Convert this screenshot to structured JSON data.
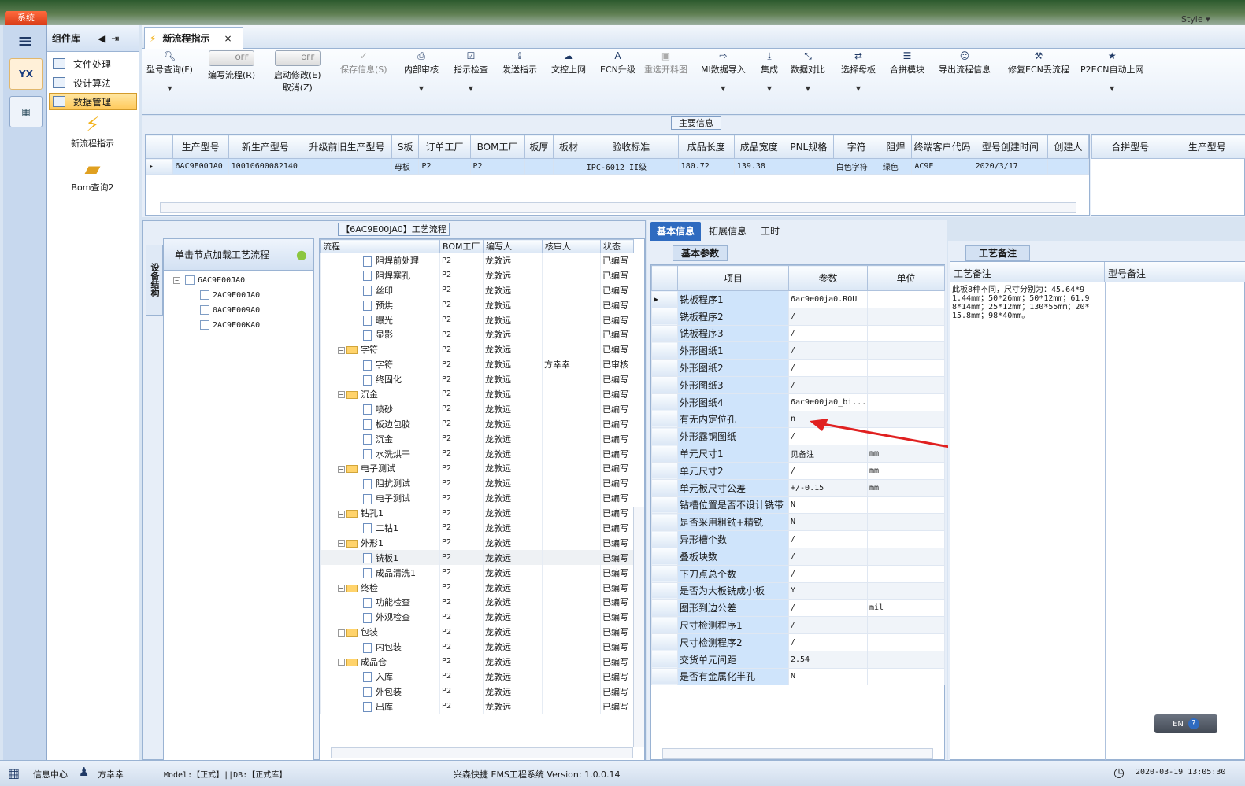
{
  "window": {
    "system_tab": "系统",
    "style_label": "Style"
  },
  "nav": {
    "tile1": "YX",
    "tile2": "▦"
  },
  "component_panel": {
    "title": "组件库",
    "items": [
      {
        "label": "文件处理"
      },
      {
        "label": "设计算法"
      },
      {
        "label": "数据管理"
      }
    ],
    "big_items": [
      {
        "label": "新流程指示"
      },
      {
        "label": "Bom查询2"
      }
    ]
  },
  "tab": {
    "label": "新流程指示",
    "close": "×"
  },
  "toolbar": {
    "model_query": "型号查询(F)",
    "edit_flow": "编写流程(R)",
    "start_modify": "启动修改(E)",
    "cancel": "取消(Z)",
    "toggle_off": "OFF",
    "save_info": "保存信息(S)",
    "internal_review": "内部审核",
    "instruction_check": "指示检查",
    "send_instruction": "发送指示",
    "doc_control_online": "文控上网",
    "ecn_upgrade": "ECN升级",
    "reselect_drawing": "重选开料图",
    "mi_import": "MI数据导入",
    "integrate": "集成",
    "data_compare": "数据对比",
    "select_master": "选择母板",
    "merge_module": "合拼模块",
    "export_flow": "导出流程信息",
    "fix_ecn": "修复ECN丢流程",
    "p2ecn": "P2ECN自动上网"
  },
  "main_info": {
    "title": "主要信息",
    "columns": [
      "生产型号",
      "新生产型号",
      "升级前旧生产型号",
      "S板",
      "订单工厂",
      "BOM工厂",
      "板厚",
      "板材",
      "验收标准",
      "成品长度",
      "成品宽度",
      "PNL规格",
      "字符",
      "阻焊",
      "终端客户代码",
      "型号创建时间",
      "创建人"
    ],
    "rows": [
      [
        "6AC9E00JA0",
        "10010600082140",
        "",
        "母板",
        "P2",
        "P2",
        "",
        "",
        "IPC-6012 II级",
        "180.72",
        "139.38",
        "",
        "白色字符",
        "绿色",
        "AC9E",
        "2020/3/17",
        ""
      ]
    ],
    "merge_columns": [
      "合拼型号",
      "生产型号"
    ]
  },
  "process": {
    "title": "【6AC9E00JA0】工艺流程",
    "side_tab": "设备结构",
    "tree_header": "单击节点加载工艺流程",
    "tree": [
      {
        "label": "6AC9E00JA0",
        "level": 0
      },
      {
        "label": "2AC9E00JA0",
        "level": 1
      },
      {
        "label": "0AC9E009A0",
        "level": 1
      },
      {
        "label": "2AC9E00KA0",
        "level": 1
      }
    ],
    "columns": [
      "流程",
      "BOM工厂",
      "编写人",
      "核审人",
      "状态"
    ],
    "rows": [
      {
        "name": "阻焊前处理",
        "type": "doc",
        "bom": "P2",
        "writer": "龙敦远",
        "reviewer": "",
        "status": "已编写"
      },
      {
        "name": "阻焊塞孔",
        "type": "doc",
        "bom": "P2",
        "writer": "龙敦远",
        "reviewer": "",
        "status": "已编写"
      },
      {
        "name": "丝印",
        "type": "doc",
        "bom": "P2",
        "writer": "龙敦远",
        "reviewer": "",
        "status": "已编写"
      },
      {
        "name": "预烘",
        "type": "doc",
        "bom": "P2",
        "writer": "龙敦远",
        "reviewer": "",
        "status": "已编写"
      },
      {
        "name": "曝光",
        "type": "doc",
        "bom": "P2",
        "writer": "龙敦远",
        "reviewer": "",
        "status": "已编写"
      },
      {
        "name": "显影",
        "type": "doc",
        "bom": "P2",
        "writer": "龙敦远",
        "reviewer": "",
        "status": "已编写"
      },
      {
        "name": "字符",
        "type": "folder",
        "bom": "P2",
        "writer": "龙敦远",
        "reviewer": "",
        "status": "已编写"
      },
      {
        "name": "字符",
        "type": "doc",
        "bom": "P2",
        "writer": "龙敦远",
        "reviewer": "方幸幸",
        "status": "已审核"
      },
      {
        "name": "终固化",
        "type": "doc",
        "bom": "P2",
        "writer": "龙敦远",
        "reviewer": "",
        "status": "已编写"
      },
      {
        "name": "沉金",
        "type": "folder",
        "bom": "P2",
        "writer": "龙敦远",
        "reviewer": "",
        "status": "已编写"
      },
      {
        "name": "喷砂",
        "type": "doc",
        "bom": "P2",
        "writer": "龙敦远",
        "reviewer": "",
        "status": "已编写"
      },
      {
        "name": "板边包胶",
        "type": "doc",
        "bom": "P2",
        "writer": "龙敦远",
        "reviewer": "",
        "status": "已编写"
      },
      {
        "name": "沉金",
        "type": "doc",
        "bom": "P2",
        "writer": "龙敦远",
        "reviewer": "",
        "status": "已编写"
      },
      {
        "name": "水洗烘干",
        "type": "doc",
        "bom": "P2",
        "writer": "龙敦远",
        "reviewer": "",
        "status": "已编写"
      },
      {
        "name": "电子测试",
        "type": "folder",
        "bom": "P2",
        "writer": "龙敦远",
        "reviewer": "",
        "status": "已编写"
      },
      {
        "name": "阻抗测试",
        "type": "doc",
        "bom": "P2",
        "writer": "龙敦远",
        "reviewer": "",
        "status": "已编写"
      },
      {
        "name": "电子测试",
        "type": "doc",
        "bom": "P2",
        "writer": "龙敦远",
        "reviewer": "",
        "status": "已编写"
      },
      {
        "name": "钻孔1",
        "type": "folder",
        "bom": "P2",
        "writer": "龙敦远",
        "reviewer": "",
        "status": "已编写"
      },
      {
        "name": "二钻1",
        "type": "doc",
        "bom": "P2",
        "writer": "龙敦远",
        "reviewer": "",
        "status": "已编写"
      },
      {
        "name": "外形1",
        "type": "folder",
        "bom": "P2",
        "writer": "龙敦远",
        "reviewer": "",
        "status": "已编写"
      },
      {
        "name": "铣板1",
        "type": "doc",
        "bom": "P2",
        "writer": "龙敦远",
        "reviewer": "",
        "status": "已编写",
        "selected": true
      },
      {
        "name": "成品清洗1",
        "type": "doc",
        "bom": "P2",
        "writer": "龙敦远",
        "reviewer": "",
        "status": "已编写"
      },
      {
        "name": "终检",
        "type": "folder",
        "bom": "P2",
        "writer": "龙敦远",
        "reviewer": "",
        "status": "已编写"
      },
      {
        "name": "功能检查",
        "type": "doc",
        "bom": "P2",
        "writer": "龙敦远",
        "reviewer": "",
        "status": "已编写"
      },
      {
        "name": "外观检查",
        "type": "doc",
        "bom": "P2",
        "writer": "龙敦远",
        "reviewer": "",
        "status": "已编写"
      },
      {
        "name": "包装",
        "type": "folder",
        "bom": "P2",
        "writer": "龙敦远",
        "reviewer": "",
        "status": "已编写"
      },
      {
        "name": "内包装",
        "type": "doc",
        "bom": "P2",
        "writer": "龙敦远",
        "reviewer": "",
        "status": "已编写"
      },
      {
        "name": "成品仓",
        "type": "folder",
        "bom": "P2",
        "writer": "龙敦远",
        "reviewer": "",
        "status": "已编写"
      },
      {
        "name": "入库",
        "type": "doc",
        "bom": "P2",
        "writer": "龙敦远",
        "reviewer": "",
        "status": "已编写"
      },
      {
        "name": "外包装",
        "type": "doc",
        "bom": "P2",
        "writer": "龙敦远",
        "reviewer": "",
        "status": "已编写"
      },
      {
        "name": "出库",
        "type": "doc",
        "bom": "P2",
        "writer": "龙敦远",
        "reviewer": "",
        "status": "已编写"
      }
    ]
  },
  "basic": {
    "tabs": [
      "基本信息",
      "拓展信息",
      "工时"
    ],
    "title": "基本参数",
    "columns": [
      "项目",
      "参数",
      "单位"
    ],
    "rows": [
      [
        "铣板程序1",
        "6ac9e00ja0.ROU",
        ""
      ],
      [
        "铣板程序2",
        "/",
        ""
      ],
      [
        "铣板程序3",
        "/",
        ""
      ],
      [
        "外形图纸1",
        "/",
        ""
      ],
      [
        "外形图纸2",
        "/",
        ""
      ],
      [
        "外形图纸3",
        "/",
        ""
      ],
      [
        "外形图纸4",
        "6ac9e00ja0_bi...",
        ""
      ],
      [
        "有无内定位孔",
        "n",
        ""
      ],
      [
        "外形露铜图纸",
        "/",
        ""
      ],
      [
        "单元尺寸1",
        "见备注",
        "mm"
      ],
      [
        "单元尺寸2",
        "/",
        "mm"
      ],
      [
        "单元板尺寸公差",
        "+/-0.15",
        "mm"
      ],
      [
        "钻槽位置是否不设计铣带",
        "N",
        ""
      ],
      [
        "是否采用粗铣+精铣",
        "N",
        ""
      ],
      [
        "异形槽个数",
        "/",
        ""
      ],
      [
        "叠板块数",
        "/",
        ""
      ],
      [
        "下刀点总个数",
        "/",
        ""
      ],
      [
        "是否为大板铣成小板",
        "Y",
        ""
      ],
      [
        "图形到边公差",
        "/",
        "mil"
      ],
      [
        "尺寸检测程序1",
        "/",
        ""
      ],
      [
        "尺寸检测程序2",
        "/",
        ""
      ],
      [
        "交货单元间距",
        "2.54",
        ""
      ],
      [
        "是否有金属化半孔",
        "N",
        ""
      ]
    ]
  },
  "remarks": {
    "title": "工艺备注",
    "col1": "工艺备注",
    "col2": "型号备注",
    "text": "此板8种不同，尺寸分别为：45.64*91.44mm；50*26mm；50*12mm；61.98*14mm；25*12mm；130*55mm；20*15.8mm；98*40mm。"
  },
  "lang": {
    "code": "EN"
  },
  "status": {
    "info_center": "信息中心",
    "user": "方幸幸",
    "model_db": "Model:【正式】||DB:【正式库】",
    "system": "兴森快捷 EMS工程系统 Version: 1.0.0.14",
    "datetime": "2020-03-19 13:05:30"
  },
  "colors": {
    "accent": "#2f6bc0",
    "highlight": "#cfe4fb",
    "arrow": "#e02020"
  }
}
